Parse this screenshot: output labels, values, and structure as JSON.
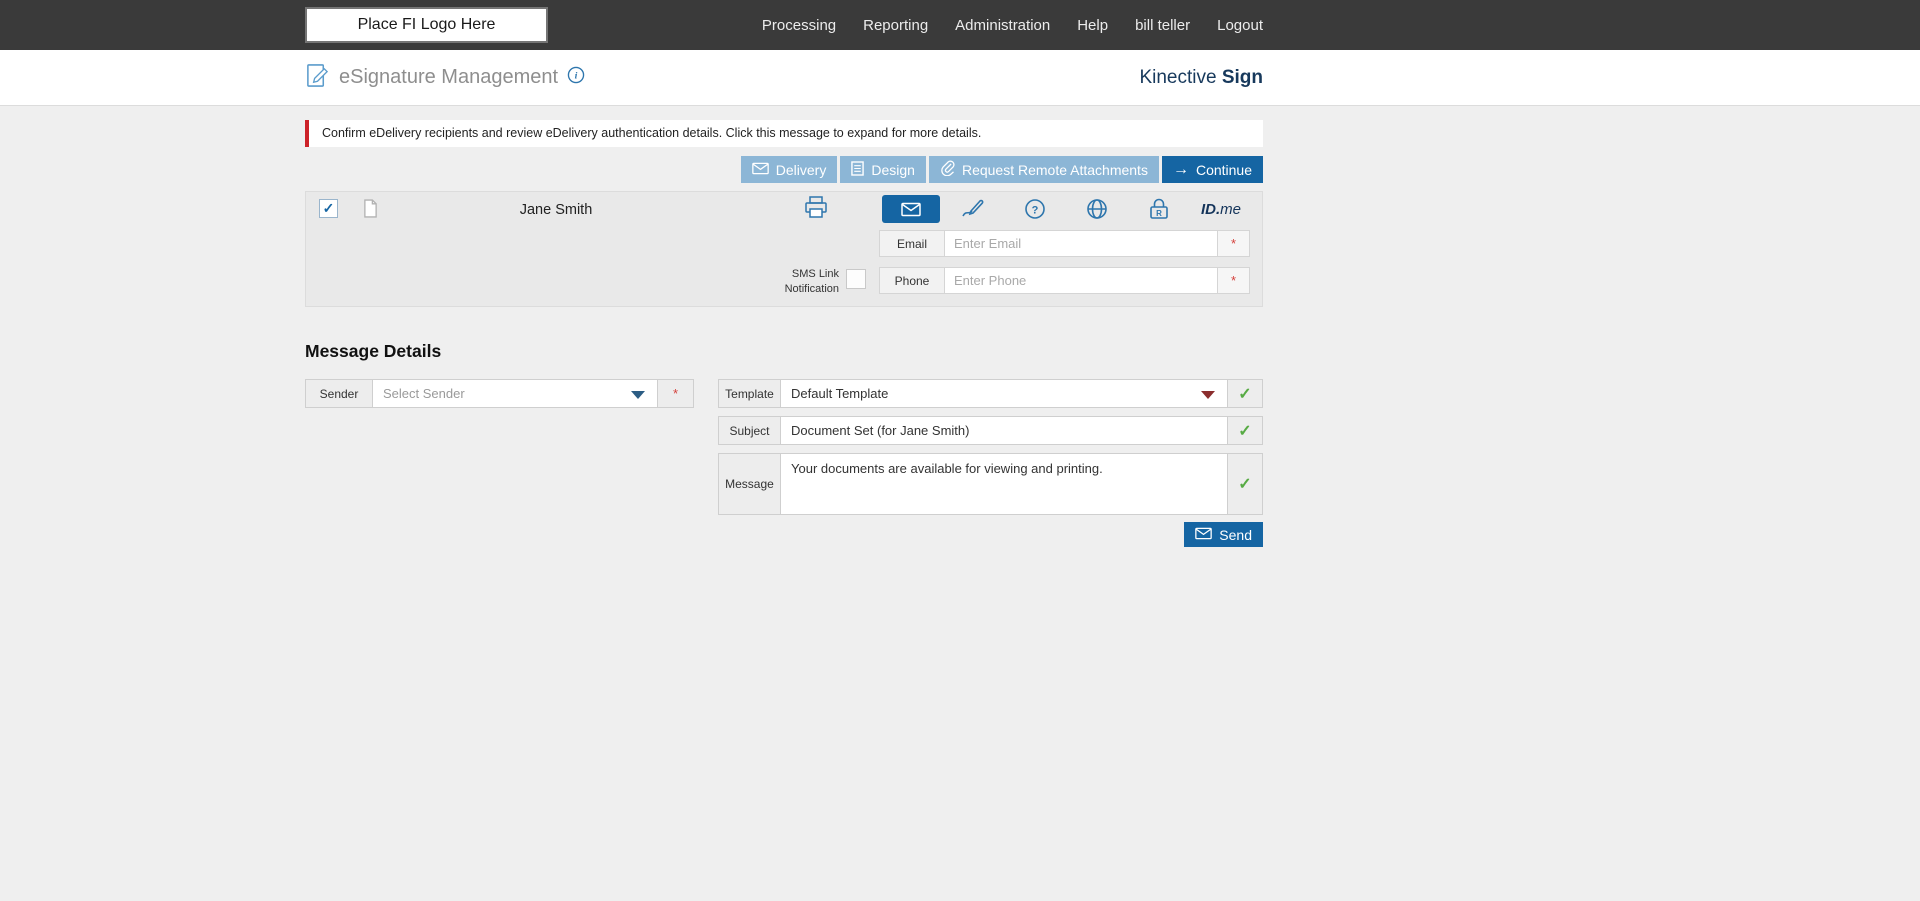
{
  "topbar": {
    "logo_placeholder": "Place FI Logo Here",
    "nav": [
      "Processing",
      "Reporting",
      "Administration",
      "Help",
      "bill teller",
      "Logout"
    ]
  },
  "header": {
    "title": "eSignature Management",
    "brand_regular": "Kinective ",
    "brand_bold": "Sign"
  },
  "alert": {
    "text": "Confirm eDelivery recipients and review eDelivery authentication details. Click this message to expand for more details."
  },
  "toolbar": {
    "delivery": "Delivery",
    "design": "Design",
    "request_remote_attachments": "Request Remote Attachments",
    "continue": "Continue"
  },
  "recipient": {
    "name": "Jane Smith",
    "email_label": "Email",
    "email_placeholder": "Enter Email",
    "phone_label": "Phone",
    "phone_placeholder": "Enter Phone",
    "sms_label": "SMS Link Notification",
    "required_marker": "*",
    "idme_prefix": "ID.",
    "idme_suffix": "me",
    "lock_letter": "R",
    "question_mark": "?"
  },
  "message_details": {
    "heading": "Message Details",
    "sender_label": "Sender",
    "sender_placeholder": "Select Sender",
    "template_label": "Template",
    "template_value": "Default Template",
    "subject_label": "Subject",
    "subject_value": "Document Set (for Jane Smith)",
    "message_label": "Message",
    "message_value": "Your documents are available for viewing and printing.",
    "send": "Send",
    "valid_marker": "✓"
  },
  "colors": {
    "accent_blue": "#1565a3",
    "light_blue_button": "#8cb6d6",
    "alert_red": "#cc2229",
    "valid_green": "#57ab44",
    "brand_navy": "#17395c",
    "topbar_gray": "#3a3a3a"
  }
}
